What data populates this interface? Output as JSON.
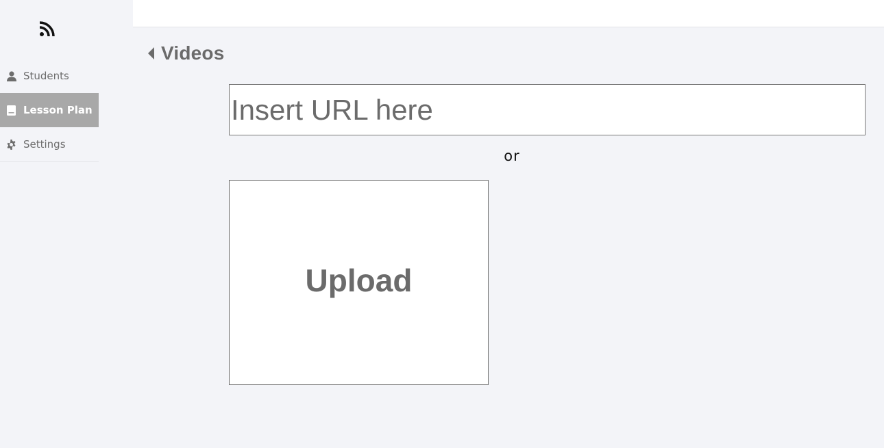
{
  "sidebar": {
    "logo_icon": "rss-icon",
    "items": [
      {
        "label": "Students",
        "icon": "user-icon",
        "active": false
      },
      {
        "label": "Lesson Plan",
        "icon": "book-icon",
        "active": true
      },
      {
        "label": "Settings",
        "icon": "gear-icon",
        "active": false
      }
    ]
  },
  "header": {
    "back_icon": "caret-left-icon",
    "title": "Videos"
  },
  "main": {
    "url_input": {
      "value": "",
      "placeholder": "Insert URL here"
    },
    "or_text": "or",
    "upload_label": "Upload"
  },
  "colors": {
    "background": "#f3f4f8",
    "active_nav": "#a8a8a8",
    "text": "#6d6d6d"
  }
}
